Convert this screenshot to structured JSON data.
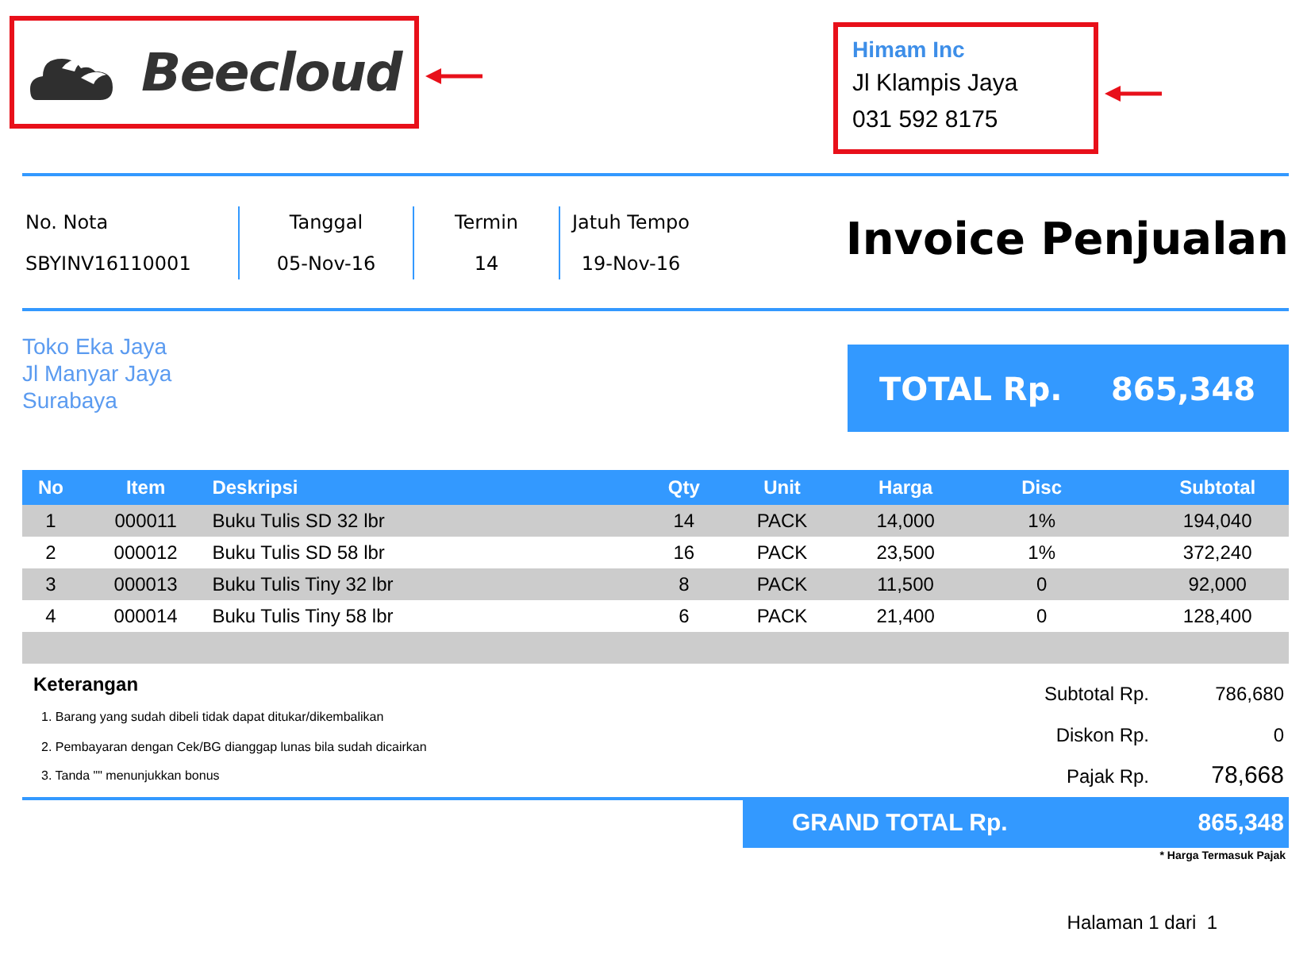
{
  "logo": {
    "text": "Beecloud"
  },
  "company": {
    "name": "Himam Inc",
    "address": "Jl Klampis Jaya",
    "phone": "031 592 8175"
  },
  "title": "Invoice Penjualan",
  "meta": [
    {
      "label": "No. Nota",
      "value": "SBYINV16110001"
    },
    {
      "label": "Tanggal",
      "value": "05-Nov-16"
    },
    {
      "label": "Termin",
      "value": "14"
    },
    {
      "label": "Jatuh Tempo",
      "value": "19-Nov-16"
    }
  ],
  "customer": [
    "Toko Eka Jaya",
    "Jl Manyar Jaya",
    "Surabaya"
  ],
  "total": {
    "label": "TOTAL Rp.",
    "value": "865,348"
  },
  "table": {
    "columns": [
      "No",
      "Item",
      "Deskripsi",
      "Qty",
      "Unit",
      "Harga",
      "Disc",
      "Subtotal"
    ],
    "rows": [
      [
        "1",
        "000011",
        "Buku Tulis SD 32 lbr",
        "14",
        "PACK",
        "14,000",
        "1%",
        "194,040"
      ],
      [
        "2",
        "000012",
        "Buku Tulis SD 58 lbr",
        "16",
        "PACK",
        "23,500",
        "1%",
        "372,240"
      ],
      [
        "3",
        "000013",
        "Buku Tulis Tiny 32 lbr",
        "8",
        "PACK",
        "11,500",
        "0",
        "92,000"
      ],
      [
        "4",
        "000014",
        "Buku Tulis Tiny 58 lbr",
        "6",
        "PACK",
        "21,400",
        "0",
        "128,400"
      ]
    ]
  },
  "notes": {
    "title": "Keterangan",
    "items": [
      "1. Barang yang sudah dibeli tidak dapat ditukar/dikembalikan",
      "2. Pembayaran dengan Cek/BG dianggap lunas bila sudah dicairkan",
      "3. Tanda \"\" menunjukkan bonus"
    ]
  },
  "summary": [
    {
      "label": "Subtotal Rp.",
      "value": "786,680",
      "kind": "normal"
    },
    {
      "label": "Diskon Rp.",
      "value": "0",
      "kind": "normal"
    },
    {
      "label": "Pajak Rp.",
      "value": "78,668",
      "kind": "large"
    }
  ],
  "grand_total": {
    "label": "GRAND TOTAL Rp.",
    "value": "865,348",
    "note": "* Harga Termasuk Pajak"
  },
  "footer": {
    "page": "Halaman 1 dari  1"
  }
}
